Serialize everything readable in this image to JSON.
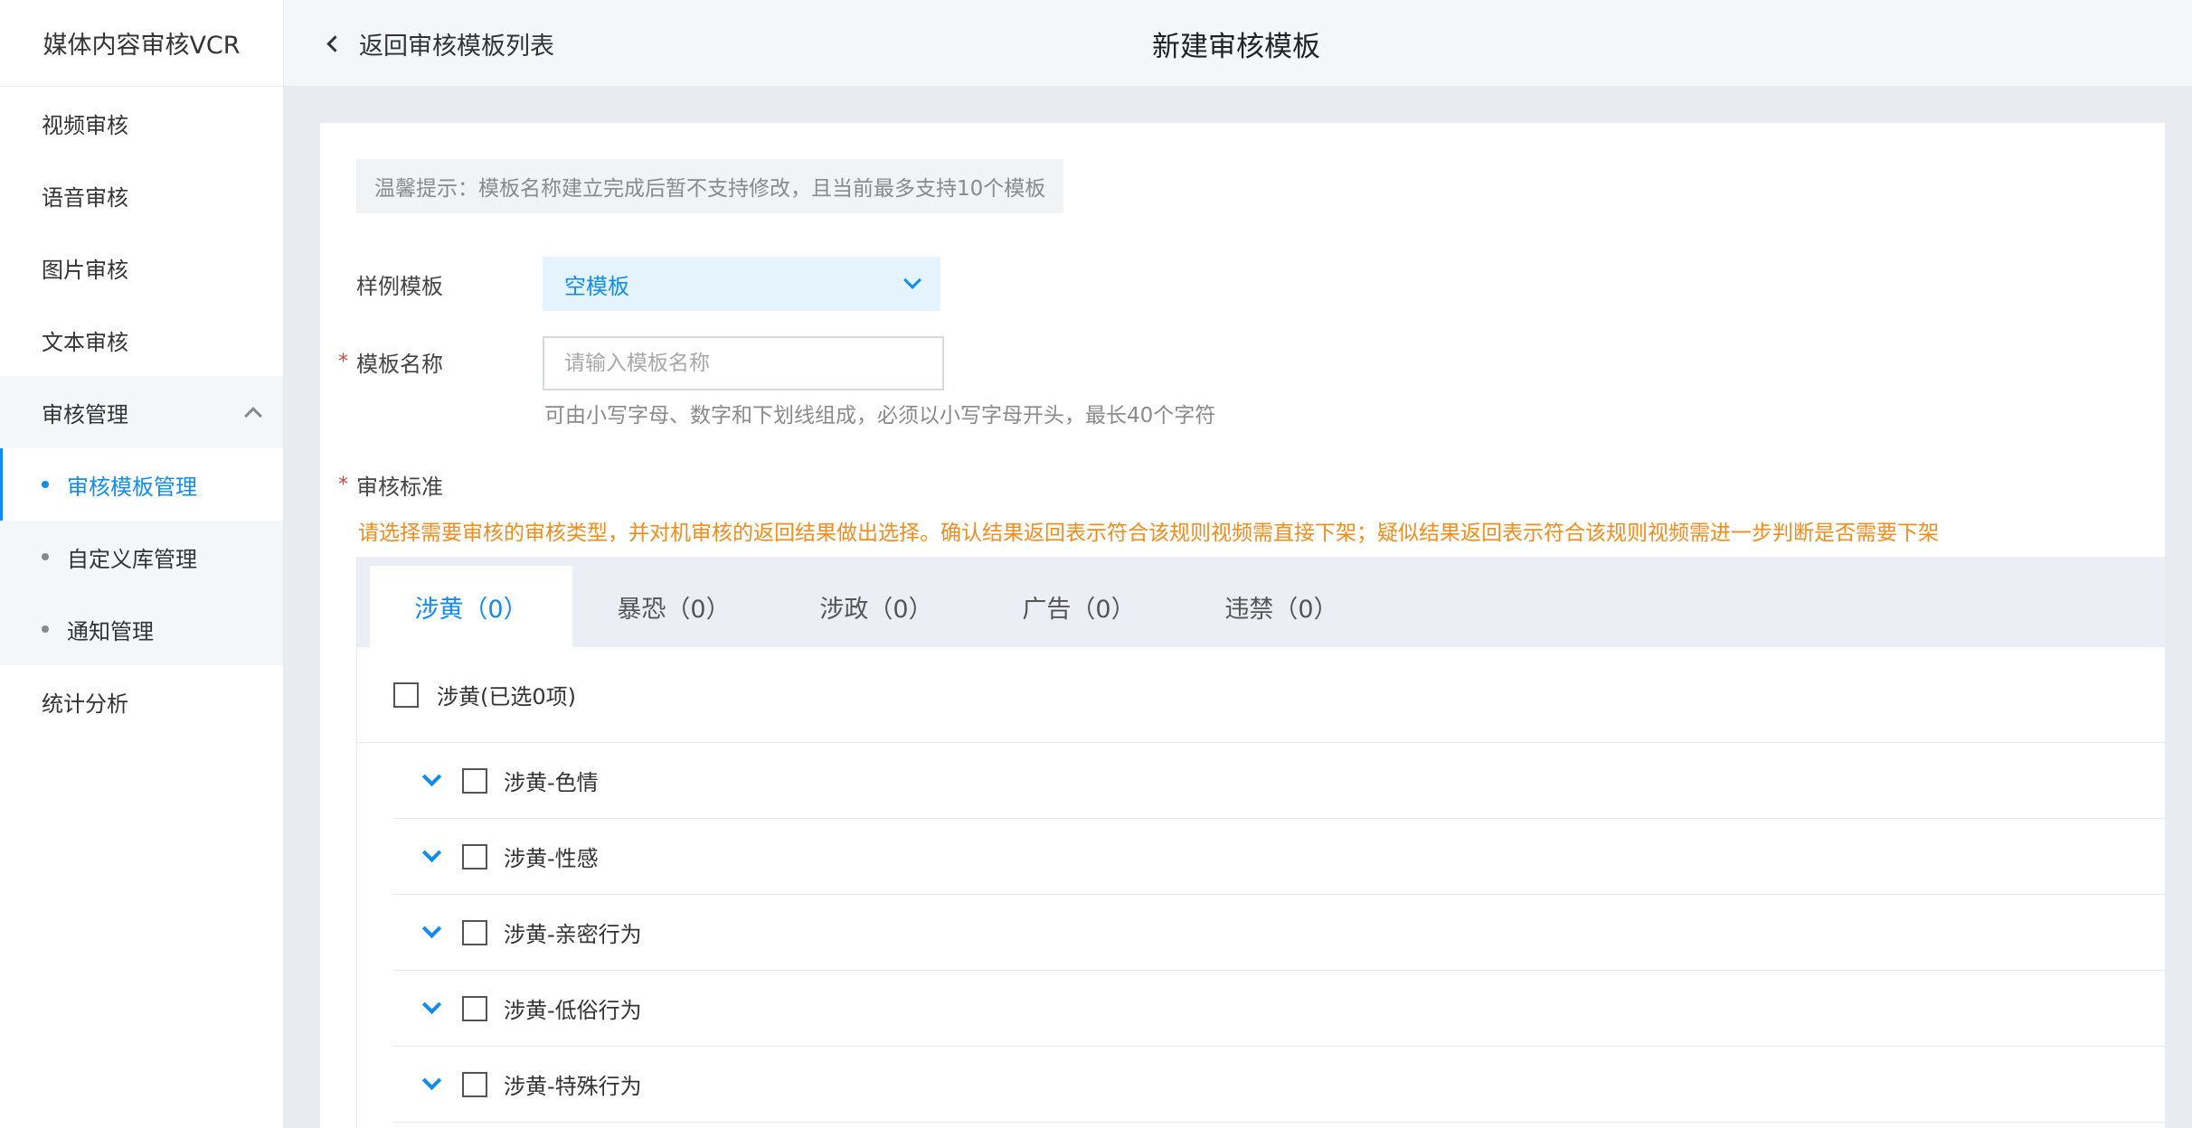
{
  "sidebar": {
    "brand": "媒体内容审核VCR",
    "items": [
      {
        "label": "视频审核"
      },
      {
        "label": "语音审核"
      },
      {
        "label": "图片审核"
      },
      {
        "label": "文本审核"
      }
    ],
    "group": {
      "label": "审核管理",
      "expanded": true,
      "children": [
        {
          "label": "审核模板管理",
          "active": true
        },
        {
          "label": "自定义库管理",
          "active": false
        },
        {
          "label": "通知管理",
          "active": false
        }
      ]
    },
    "bottom_item": {
      "label": "统计分析"
    }
  },
  "header": {
    "back_label": "返回审核模板列表",
    "title": "新建审核模板"
  },
  "form": {
    "tip": "温馨提示：模板名称建立完成后暂不支持修改，且当前最多支持10个模板",
    "sample_label": "样例模板",
    "sample_value": "空模板",
    "name_label": "模板名称",
    "name_placeholder": "请输入模板名称",
    "name_value": "",
    "name_hint": "可由小写字母、数字和下划线组成，必须以小写字母开头，最长40个字符",
    "standard_label": "审核标准",
    "standard_warning": "请选择需要审核的审核类型，并对机审核的返回结果做出选择。确认结果返回表示符合该规则视频需直接下架；疑似结果返回表示符合该规则视频需进一步判断是否需要下架",
    "required_mark": "*"
  },
  "tabs": [
    {
      "label": "涉黄（0）",
      "active": true
    },
    {
      "label": "暴恐（0）",
      "active": false
    },
    {
      "label": "涉政（0）",
      "active": false
    },
    {
      "label": "广告（0）",
      "active": false
    },
    {
      "label": "违禁（0）",
      "active": false
    }
  ],
  "category_panel": {
    "select_all_label": "涉黄(已选0项)",
    "items": [
      {
        "label": "涉黄-色情",
        "checked": false
      },
      {
        "label": "涉黄-性感",
        "checked": false
      },
      {
        "label": "涉黄-亲密行为",
        "checked": false
      },
      {
        "label": "涉黄-低俗行为",
        "checked": false
      },
      {
        "label": "涉黄-特殊行为",
        "checked": false
      }
    ]
  },
  "colors": {
    "accent": "#108cee",
    "warning": "#f28c1d",
    "required": "#e8412f",
    "page_bg": "#e8ecf1"
  }
}
